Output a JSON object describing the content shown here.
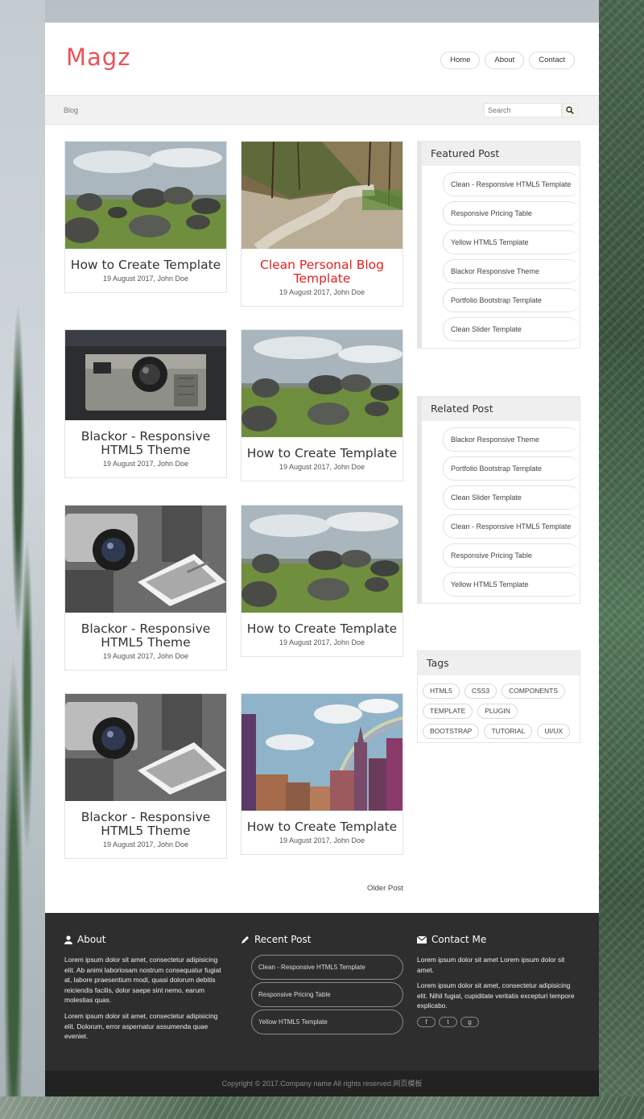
{
  "brand": {
    "logo": "Magz",
    "accent": "#e8535a"
  },
  "nav": {
    "items": [
      "Home",
      "About",
      "Contact"
    ]
  },
  "breadcrumb": "Blog",
  "search": {
    "placeholder": "Search"
  },
  "posts": [
    {
      "title": "How to Create Template",
      "meta": "19 August 2017, John Doe",
      "image": "stones-field",
      "highlight": false
    },
    {
      "title": "Clean Personal Blog Template",
      "meta": "19 August 2017, John Doe",
      "image": "forest-road",
      "highlight": true
    },
    {
      "title": "Blackor - Responsive HTML5 Theme",
      "meta": "19 August 2017, John Doe",
      "image": "camera-closeup",
      "highlight": false
    },
    {
      "title": "How to Create Template",
      "meta": "19 August 2017, John Doe",
      "image": "stones-field",
      "highlight": false
    },
    {
      "title": "Blackor - Responsive HTML5 Theme",
      "meta": "19 August 2017, John Doe",
      "image": "camera-photo",
      "highlight": false
    },
    {
      "title": "How to Create Template",
      "meta": "19 August 2017, John Doe",
      "image": "stones-field",
      "highlight": false
    },
    {
      "title": "Blackor - Responsive HTML5 Theme",
      "meta": "19 August 2017, John Doe",
      "image": "camera-photo",
      "highlight": false
    },
    {
      "title": "How to Create Template",
      "meta": "19 August 2017, John Doe",
      "image": "city-rainbow",
      "highlight": false
    }
  ],
  "pagination": {
    "older": "Older Post"
  },
  "sidebar": {
    "featured": {
      "title": "Featured Post",
      "items": [
        "Clean - Responsive HTML5 Template",
        "Responsive Pricing Table",
        "Yellow HTML5 Template",
        "Blackor Responsive Theme",
        "Portfolio Bootstrap Template",
        "Clean Slider Template"
      ]
    },
    "related": {
      "title": "Related Post",
      "items": [
        "Blackor Responsive Theme",
        "Portfolio Bootstrap Template",
        "Clean Slider Template",
        "Clean - Responsive HTML5 Template",
        "Responsive Pricing Table",
        "Yellow HTML5 Template"
      ]
    },
    "tags": {
      "title": "Tags",
      "items": [
        "HTML5",
        "CSS3",
        "COMPONENTS",
        "TEMPLATE",
        "PLUGIN",
        "BOOTSTRAP",
        "TUTORIAL",
        "UI/UX"
      ]
    }
  },
  "footer": {
    "about": {
      "title": "About",
      "p1": "Lorem ipsum dolor sit amet, consectetur adipisicing elit. Ab animi laboriosam nostrum consequatur fugiat at, labore praesentium modi, quasi dolorum debitis reiciendis facilis, dolor saepe sint nemo, earum molestias quas.",
      "p2": "Lorem ipsum dolor sit amet, consectetur adipisicing elit. Dolorum, error aspernatur assumenda quae eveniet."
    },
    "recent": {
      "title": "Recent Post",
      "items": [
        "Clean - Responsive HTML5 Template",
        "Responsive Pricing Table",
        "Yellow HTML5 Template"
      ]
    },
    "contact": {
      "title": "Contact Me",
      "p1": "Lorem ipsum dolor sit amet Lorem ipsum dolor sit amet.",
      "p2": "Lorem ipsum dolor sit amet, consectetur adipisicing elit. Nihil fugiat, cupiditate veritatis excepturi tempore explicabo.",
      "socials": [
        "f",
        "t",
        "g"
      ]
    },
    "copyright": "Copyright © 2017.Company name All rights reserved.网页模板"
  }
}
